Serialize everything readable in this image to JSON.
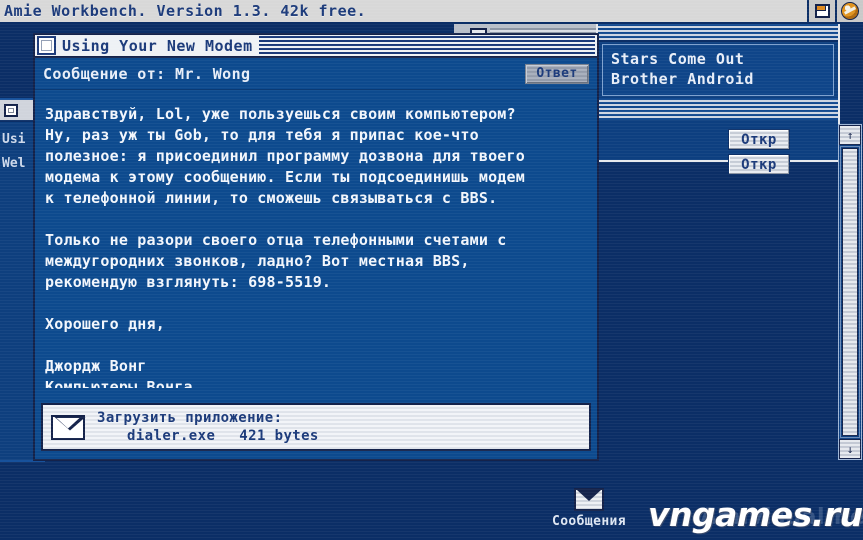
{
  "workbench": {
    "title": "Amie Workbench.  Version 1.3.  42k free.",
    "gadgets": [
      {
        "name": "depth-gadget",
        "label": ""
      },
      {
        "name": "ball-gadget",
        "label": ""
      }
    ]
  },
  "background_window_left": {
    "fragment_line1": "Usi",
    "fragment_line2": "Wel"
  },
  "right_panel": {
    "items": [
      {
        "label": "Stars Come Out",
        "button": "Откр"
      },
      {
        "label": "Brother Android",
        "button": "Откр"
      }
    ]
  },
  "scrollbar": {
    "up_arrow": "↑",
    "down_arrow": "↓"
  },
  "message_window": {
    "title": "Using Your New Modem",
    "from_label": "Сообщение от: Mr. Wong",
    "reply_button": "Ответ",
    "body": "Здравствуй, Lol, уже пользуешься своим компьютером?\nНу, раз уж ты Gob, то для тебя я припас кое-что\nполезное: я присоединил программу дозвона для твоего\nмодема к этому сообщению. Если ты подсоединишь модем\nк телефонной линии, то сможешь связываться с BBS.\n\nТолько не разори своего отца телефонными счетами с\nмеждугородних звонков, ладно? Вот местная BBS,\nрекомендую взглянуть: 698-5519.\n\nХорошего дня,\n\nДжордж Вонг\nКомпьютеры Вонга",
    "attachment": {
      "prompt": "Загрузить приложение:",
      "filename": "dialer.exe",
      "filesize": "421 bytes"
    }
  },
  "desktop_icon": {
    "label": "Сообщения"
  },
  "watermark": {
    "front": "vngames.ru",
    "back": "Amivisual.net"
  },
  "colors": {
    "desktop": "#0b2e66",
    "window_body": "#0d4a8e",
    "titlebar": "#eef1f5",
    "title_text": "#1b3a7a",
    "body_text": "#f2f6fc",
    "accent_orange": "#e0931f"
  }
}
